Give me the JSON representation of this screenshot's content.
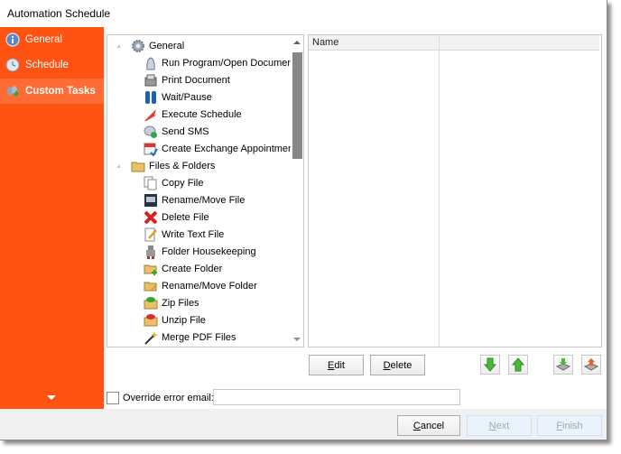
{
  "window": {
    "title": "Automation Schedule"
  },
  "sidebar": {
    "accent_color": "#ff5313",
    "items": [
      {
        "label": "General",
        "icon": "info-icon",
        "active": false
      },
      {
        "label": "Schedule",
        "icon": "clock-icon",
        "active": false
      },
      {
        "label": "Custom Tasks",
        "icon": "custom-tasks-icon",
        "active": true
      }
    ],
    "more_icon": "chevron-down-icon"
  },
  "task_tree": {
    "groups": [
      {
        "label": "General",
        "icon": "gear-icon",
        "expanded": true,
        "items": [
          {
            "label": "Run Program/Open Document",
            "icon": "run-program-icon"
          },
          {
            "label": "Print Document",
            "icon": "printer-icon"
          },
          {
            "label": "Wait/Pause",
            "icon": "pause-icon"
          },
          {
            "label": "Execute Schedule",
            "icon": "execute-schedule-icon"
          },
          {
            "label": "Send SMS",
            "icon": "sms-icon"
          },
          {
            "label": "Create Exchange Appointment",
            "icon": "calendar-icon"
          }
        ]
      },
      {
        "label": "Files & Folders",
        "icon": "folder-icon",
        "expanded": true,
        "items": [
          {
            "label": "Copy File",
            "icon": "copy-file-icon"
          },
          {
            "label": "Rename/Move File",
            "icon": "rename-file-icon"
          },
          {
            "label": "Delete File",
            "icon": "delete-icon"
          },
          {
            "label": "Write Text File",
            "icon": "write-text-icon"
          },
          {
            "label": "Folder Housekeeping",
            "icon": "housekeeping-icon"
          },
          {
            "label": "Create Folder",
            "icon": "create-folder-icon"
          },
          {
            "label": "Rename/Move Folder",
            "icon": "rename-folder-icon"
          },
          {
            "label": "Zip Files",
            "icon": "zip-icon"
          },
          {
            "label": "Unzip File",
            "icon": "unzip-icon"
          },
          {
            "label": "Merge PDF Files",
            "icon": "merge-pdf-icon"
          }
        ]
      }
    ]
  },
  "task_list": {
    "columns": [
      "Name",
      ""
    ],
    "rows": []
  },
  "actions": {
    "edit": {
      "label": "Edit",
      "mnemonic": "E",
      "rest": "dit"
    },
    "delete": {
      "label": "Delete",
      "mnemonic": "D",
      "rest": "elete"
    },
    "move_down_icon": "arrow-down-icon",
    "move_up_icon": "arrow-up-icon",
    "import_icon": "import-icon",
    "export_icon": "export-icon"
  },
  "override": {
    "label": "Override error email:",
    "checked": false,
    "value": ""
  },
  "footer": {
    "cancel": {
      "label": "Cancel",
      "mnemonic": "C",
      "rest": "ancel",
      "enabled": true
    },
    "next": {
      "label": "Next",
      "mnemonic": "N",
      "rest": "ext",
      "enabled": false
    },
    "finish": {
      "label": "Finish",
      "mnemonic": "F",
      "rest": "inish",
      "enabled": false
    }
  }
}
